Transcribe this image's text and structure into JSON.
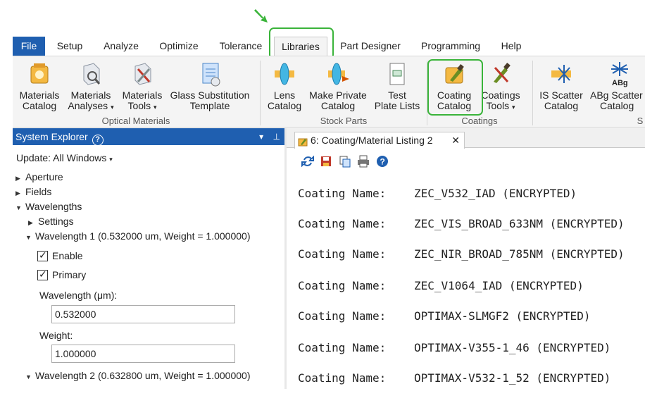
{
  "tabs": [
    {
      "label": "File"
    },
    {
      "label": "Setup"
    },
    {
      "label": "Analyze"
    },
    {
      "label": "Optimize"
    },
    {
      "label": "Tolerance"
    },
    {
      "label": "Libraries"
    },
    {
      "label": "Part Designer"
    },
    {
      "label": "Programming"
    },
    {
      "label": "Help"
    }
  ],
  "active_tab": "Libraries",
  "ribbon": {
    "groups": [
      {
        "label": "Optical Materials"
      },
      {
        "label": "Stock Parts"
      },
      {
        "label": "Coatings"
      },
      {
        "label": "S"
      }
    ],
    "buttons": [
      {
        "line1": "Materials",
        "line2": "Catalog",
        "icon": "materials-catalog-icon"
      },
      {
        "line1": "Materials",
        "line2": "Analyses",
        "icon": "materials-analyses-icon"
      },
      {
        "line1": "Materials",
        "line2": "Tools",
        "icon": "materials-tools-icon"
      },
      {
        "line1": "Glass Substitution",
        "line2": "Template",
        "icon": "glass-substitution-icon"
      },
      {
        "line1": "Lens",
        "line2": "Catalog",
        "icon": "lens-catalog-icon"
      },
      {
        "line1": "Make Private",
        "line2": "Catalog",
        "icon": "make-private-catalog-icon"
      },
      {
        "line1": "Test",
        "line2": "Plate Lists",
        "icon": "test-plate-lists-icon"
      },
      {
        "line1": "Coating",
        "line2": "Catalog",
        "icon": "coating-catalog-icon"
      },
      {
        "line1": "Coatings",
        "line2": "Tools",
        "icon": "coatings-tools-icon"
      },
      {
        "line1": "IS Scatter",
        "line2": "Catalog",
        "icon": "is-scatter-icon"
      },
      {
        "line1": "ABg Scatter",
        "line2": "Catalog",
        "icon": "abg-scatter-icon"
      }
    ],
    "abg_icon_text": "ABg"
  },
  "system_explorer": {
    "title": "System Explorer",
    "help_glyph": "?",
    "update_label": "Update: All Windows",
    "tree": [
      "Aperture",
      "Fields",
      "Wavelengths",
      "Settings",
      "Wavelength 1 (0.532000 um, Weight = 1.000000)",
      "Enable",
      "Primary",
      "Wavelength (μm):",
      "Weight:",
      "Wavelength 2 (0.632800 um, Weight = 1.000000)"
    ],
    "wavelength_value": "0.532000",
    "weight_value": "1.000000"
  },
  "document": {
    "tab_title": "6: Coating/Material Listing 2",
    "close_glyph": "✕",
    "entry_label": "Coating Name:",
    "entries": [
      "ZEC_V532_IAD (ENCRYPTED)",
      "ZEC_VIS_BROAD_633NM (ENCRYPTED)",
      "ZEC_NIR_BROAD_785NM (ENCRYPTED)",
      "ZEC_V1064_IAD (ENCRYPTED)",
      "OPTIMAX-SLMGF2 (ENCRYPTED)",
      "OPTIMAX-V355-1_46 (ENCRYPTED)",
      "OPTIMAX-V532-1_52 (ENCRYPTED)"
    ]
  },
  "colors": {
    "accent": "#1f5fb0",
    "annotation_green": "#3ab43a"
  }
}
